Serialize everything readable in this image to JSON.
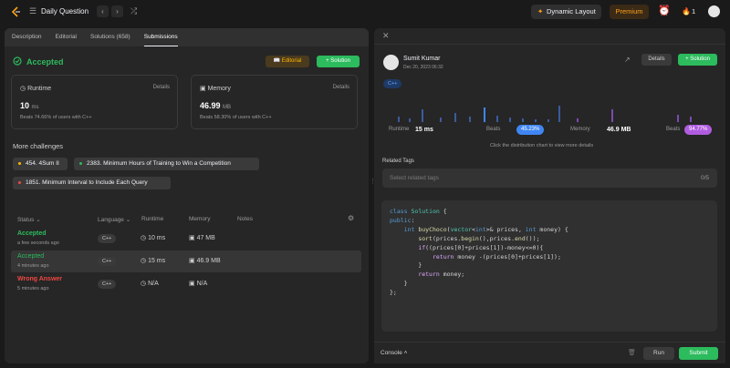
{
  "app": {
    "title": "Daily Question",
    "dynamic_layout": "Dynamic Layout",
    "premium": "Premium",
    "streak": "1",
    "prev": "‹",
    "next": "›"
  },
  "tabs": [
    "Description",
    "Editorial",
    "Solutions (658)",
    "Submissions"
  ],
  "result": {
    "status": "Accepted",
    "editorial": "Editorial",
    "solution": "Solution",
    "runtime": {
      "label": "Runtime",
      "details": "Details",
      "value": "10",
      "unit": "ms",
      "beats": "Beats 74.66% of users with C++"
    },
    "memory": {
      "label": "Memory",
      "details": "Details",
      "value": "46.99",
      "unit": "MB",
      "beats": "Beats 58.30% of users with C++"
    }
  },
  "challenges": {
    "heading": "More challenges",
    "items": [
      {
        "label": "454. 4Sum II",
        "dot": "#ffb800"
      },
      {
        "label": "2383. Minimum Hours of Training to Win a Competition",
        "dot": "#2cbb5d"
      },
      {
        "label": "1851. Minimum Interval to Include Each Query",
        "dot": "#ef4743"
      }
    ]
  },
  "table": {
    "headers": [
      "Status",
      "Language",
      "Runtime",
      "Memory",
      "Notes"
    ],
    "rows": [
      {
        "status": "Accepted",
        "ago": "a few seconds ago",
        "lang": "C++",
        "runtime": "10 ms",
        "memory": "47 MB",
        "color": "#2cbb5d"
      },
      {
        "status": "Accepted",
        "ago": "4 minutes ago",
        "lang": "C++",
        "runtime": "15 ms",
        "memory": "46.9 MB",
        "color": "#2cbb5d"
      },
      {
        "status": "Wrong Answer",
        "ago": "5 minutes ago",
        "lang": "C++",
        "runtime": "N/A",
        "memory": "N/A",
        "color": "#ef4743"
      }
    ]
  },
  "detail": {
    "user": "Sumit Kumar",
    "date": "Dec 20, 2023 06:32",
    "details": "Details",
    "solution": "Solution",
    "lang": "C++",
    "runtime_label": "Runtime",
    "runtime_value": "15 ms",
    "beats_label": "Beats",
    "runtime_beats": "45.23%",
    "memory_label": "Memory",
    "memory_value": "46.9 MB",
    "memory_beats": "94.77%",
    "hint": "Click the distribution chart to view more details",
    "related": "Related Tags",
    "tags_placeholder": "Select related tags",
    "tags_count": "0/5"
  },
  "code": [
    "class Solution {",
    "public:",
    "    int buyChoco(vector<int>& prices, int money) {",
    "        sort(prices.begin(),prices.end());",
    "        if((prices[0]+prices[1])-money<=0){",
    "            return money -(prices[0]+prices[1]);",
    "        }",
    "        return money;",
    "    }",
    "};"
  ],
  "console": {
    "label": "Console",
    "run": "Run",
    "submit": "Submit"
  }
}
